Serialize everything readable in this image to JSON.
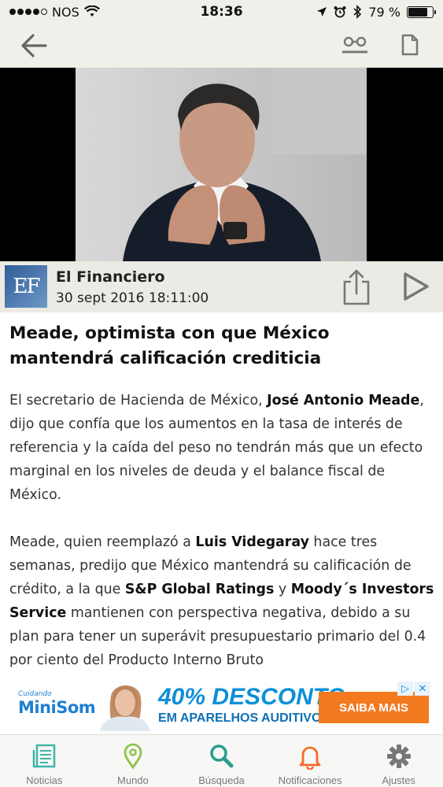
{
  "status_bar": {
    "carrier": "NOS",
    "time": "18:36",
    "battery_text": "79 %",
    "battery_level": 0.79
  },
  "source": {
    "logo_text": "EF",
    "name": "El Financiero",
    "date": "30 sept 2016 18:11:00"
  },
  "article": {
    "title": "Meade, optimista con que México mantendrá calificación crediticia",
    "p1": {
      "a": "El secretario de Hacienda de México, ",
      "b": "José Antonio Meade",
      "c": ", dijo que confía que los aumentos en la tasa de interés de referencia y la caída del peso no tendrán más que un efecto marginal en los niveles de deuda y el balance fiscal de México."
    },
    "p2": {
      "a": "Meade, quien reemplazó a ",
      "b": "Luis Videgaray",
      "c": " hace tres semanas, predijo que México mantendrá su calificación de crédito, a la que ",
      "d": "S&P Global Ratings",
      "e": " y ",
      "f": "Moody´s Investors Service",
      "g": " mantienen con perspectiva negativa, debido a su plan para tener un superávit presupuestario primario del 0.4 por ciento del Producto Interno Bruto"
    }
  },
  "ad": {
    "brand_small": "Cuidando",
    "brand_name": "MiniSom",
    "headline": "40% DESCONTO",
    "subline": "EM APARELHOS AUDITIVOS",
    "cta": "SAIBA MAIS"
  },
  "tabs": [
    {
      "label": "Noticias",
      "icon": "news-icon",
      "color": "#3fb6a8"
    },
    {
      "label": "Mundo",
      "icon": "map-pin-icon",
      "color": "#8bc34a"
    },
    {
      "label": "Búsqueda",
      "icon": "search-icon",
      "color": "#2a9d8f"
    },
    {
      "label": "Notificaciones",
      "icon": "bell-icon",
      "color": "#f26b2a"
    },
    {
      "label": "Ajustes",
      "icon": "gear-icon",
      "color": "#777777"
    }
  ]
}
